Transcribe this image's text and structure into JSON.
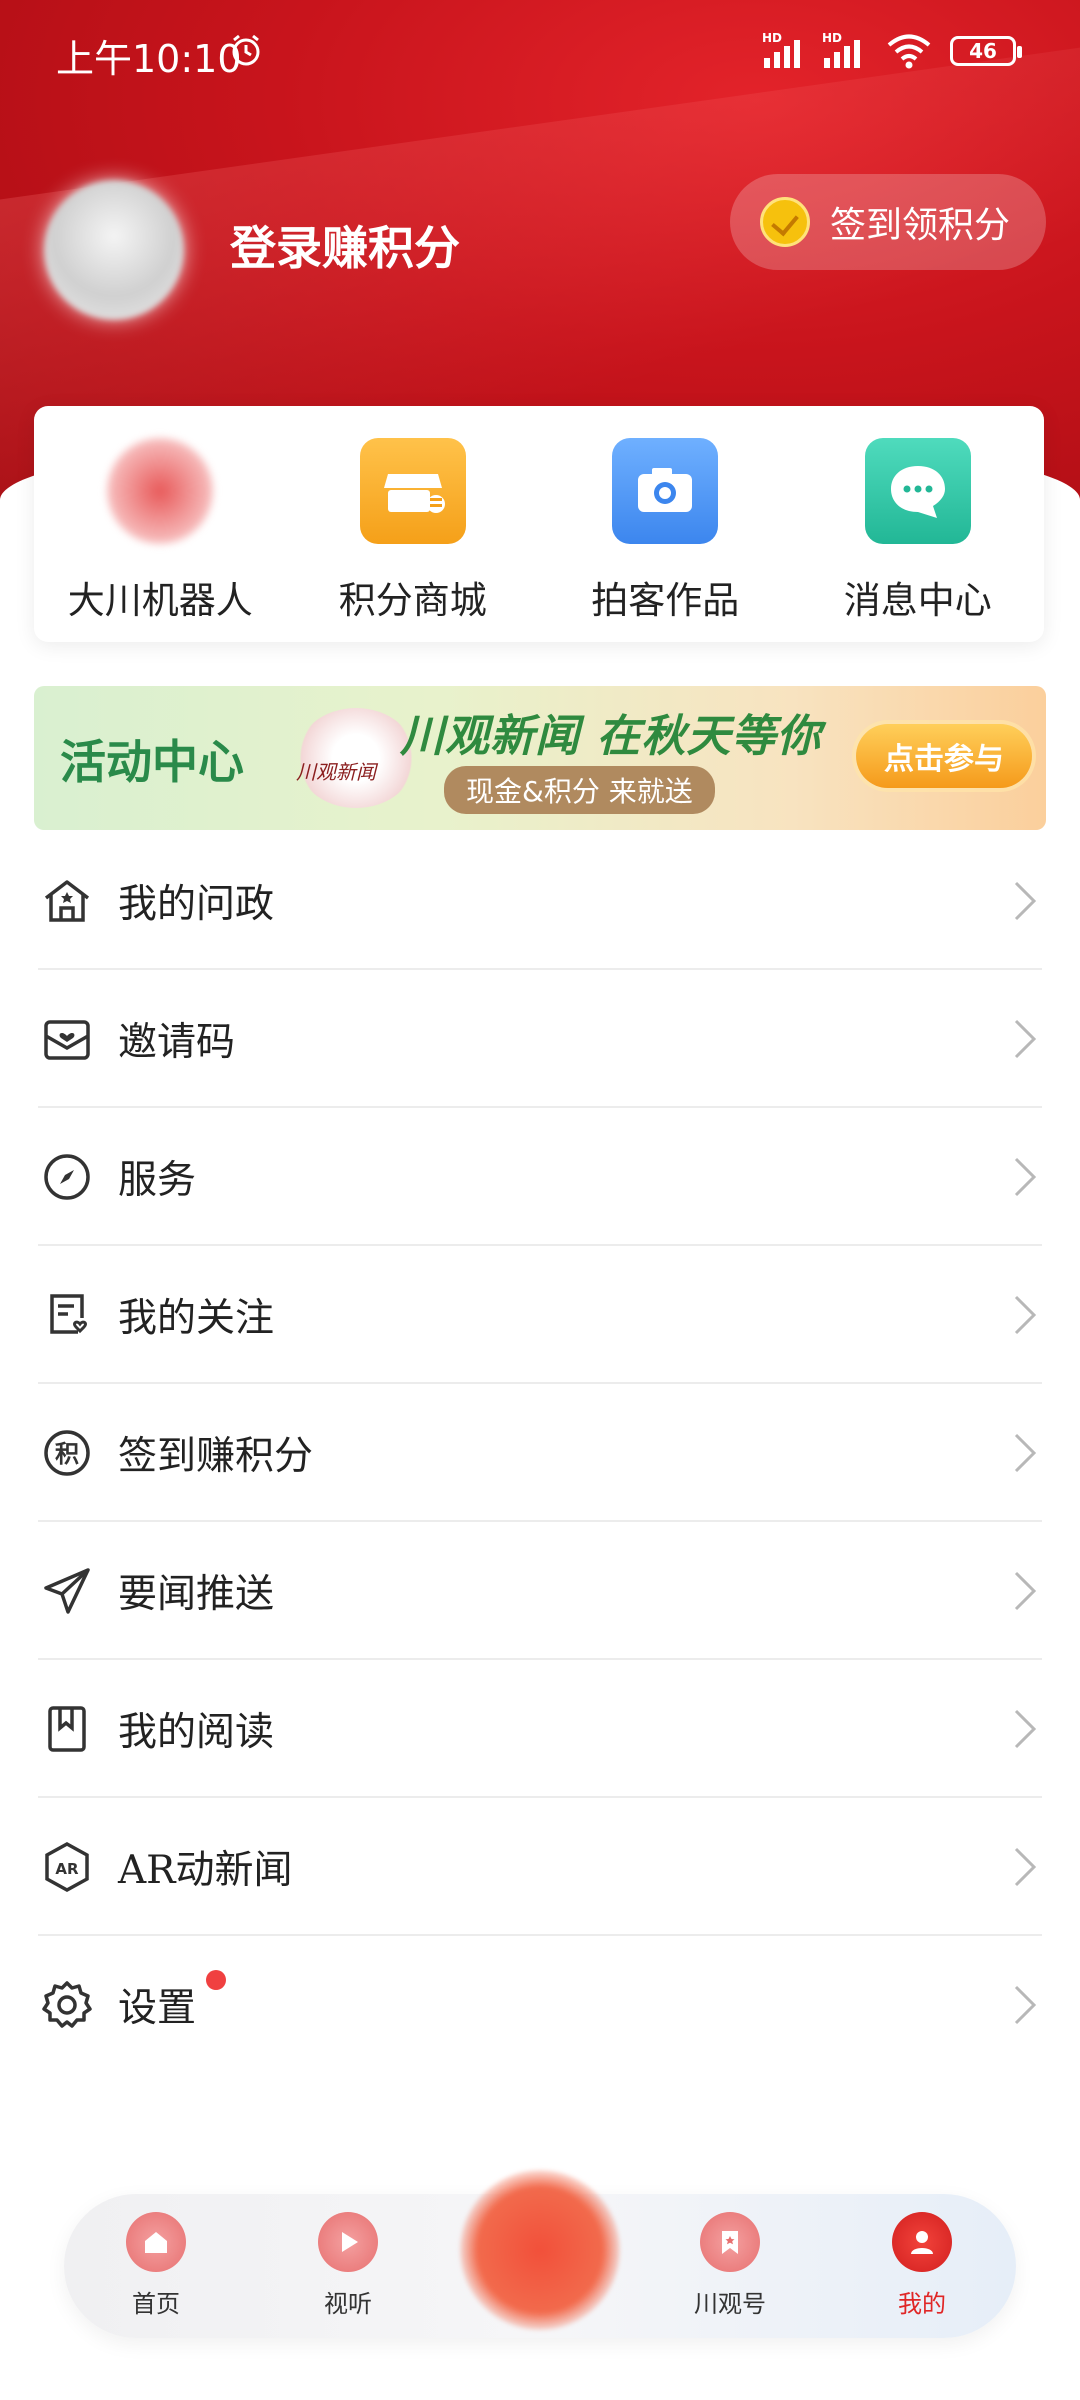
{
  "status_bar": {
    "time": "上午10:10",
    "battery": "46",
    "signal_labels": [
      "HD",
      "HD"
    ]
  },
  "header": {
    "login_text": "登录赚积分",
    "signin_button": "签到领积分"
  },
  "quick_actions": [
    {
      "label": "大川机器人",
      "icon": "robot-icon"
    },
    {
      "label": "积分商城",
      "icon": "shop-icon"
    },
    {
      "label": "拍客作品",
      "icon": "camera-icon"
    },
    {
      "label": "消息中心",
      "icon": "chat-bubble-icon"
    }
  ],
  "banner": {
    "left_text": "活动中心",
    "logo_text": "川观新闻",
    "title": "川观新闻 在秋天等你",
    "subtitle": "现金&积分 来就送",
    "button": "点击参与"
  },
  "menu": [
    {
      "label": "我的问政",
      "icon": "house-icon"
    },
    {
      "label": "邀请码",
      "icon": "mail-heart-icon"
    },
    {
      "label": "服务",
      "icon": "compass-icon"
    },
    {
      "label": "我的关注",
      "icon": "follow-list-icon"
    },
    {
      "label": "签到赚积分",
      "icon": "points-icon"
    },
    {
      "label": "要闻推送",
      "icon": "paper-plane-icon"
    },
    {
      "label": "我的阅读",
      "icon": "bookmark-book-icon"
    },
    {
      "label": "AR动新闻",
      "icon": "ar-hexagon-icon"
    },
    {
      "label": "设置",
      "icon": "gear-icon",
      "badge": true
    }
  ],
  "tabbar": {
    "tabs": [
      {
        "label": "首页",
        "icon": "home-icon"
      },
      {
        "label": "视听",
        "icon": "play-icon"
      },
      {
        "label": "川观号",
        "icon": "bookmark-star-icon"
      },
      {
        "label": "我的",
        "icon": "user-icon",
        "active": true
      }
    ]
  },
  "colors": {
    "brand_red": "#c8141c",
    "active_tab": "#e02626",
    "badge": "#f04040"
  }
}
